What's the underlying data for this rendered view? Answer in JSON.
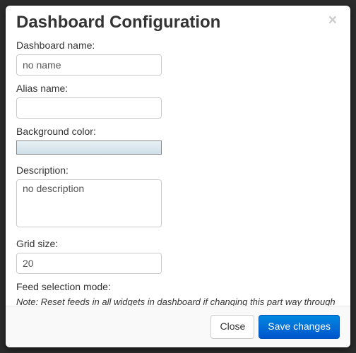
{
  "modal": {
    "title": "Dashboard Configuration",
    "close_symbol": "×"
  },
  "form": {
    "dashboard_name": {
      "label": "Dashboard name:",
      "value": "no name"
    },
    "alias_name": {
      "label": "Alias name:",
      "value": ""
    },
    "background_color": {
      "label": "Background color:",
      "value": "#e0ecf0"
    },
    "description": {
      "label": "Description:",
      "value": "no description"
    },
    "grid_size": {
      "label": "Grid size:",
      "value": "20"
    },
    "feed_selection": {
      "label": "Feed selection mode:",
      "note": "Note: Reset feeds in all widgets in dashboard if changing this part way through a dashboard build"
    }
  },
  "footer": {
    "close_label": "Close",
    "save_label": "Save changes"
  }
}
